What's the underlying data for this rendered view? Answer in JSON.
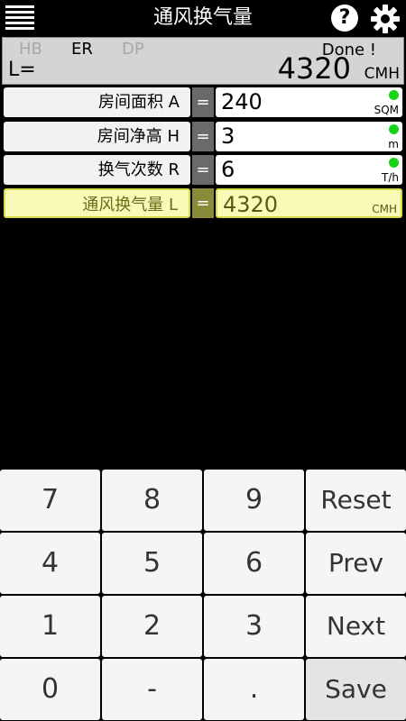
{
  "header": {
    "title": "通风换气量"
  },
  "display": {
    "modes": [
      "HB",
      "ER",
      "DP"
    ],
    "label": "L=",
    "status": "Done !",
    "value": "4320",
    "unit": "CMH"
  },
  "rows": [
    {
      "label": "房间面积  A",
      "eq": "=",
      "value": "240",
      "unit": "SQM",
      "indicator_color": "#19d219"
    },
    {
      "label": "房间净高  H",
      "eq": "=",
      "value": "3",
      "unit": "m",
      "indicator_color": "#19d219"
    },
    {
      "label": "换气次数  R",
      "eq": "=",
      "value": "6",
      "unit": "T/h",
      "indicator_color": "#19d219"
    },
    {
      "label": "通风换气量  L",
      "eq": "=",
      "value": "4320",
      "unit": "CMH"
    }
  ],
  "keypad": {
    "keys": [
      "7",
      "8",
      "9",
      "Reset",
      "4",
      "5",
      "6",
      "Prev",
      "1",
      "2",
      "3",
      "Next",
      "0",
      "-",
      ".",
      "Save"
    ]
  },
  "colors": {
    "active_bg": "#fafab8",
    "active_border": "#d9d94a",
    "indicator": "#19d219"
  }
}
